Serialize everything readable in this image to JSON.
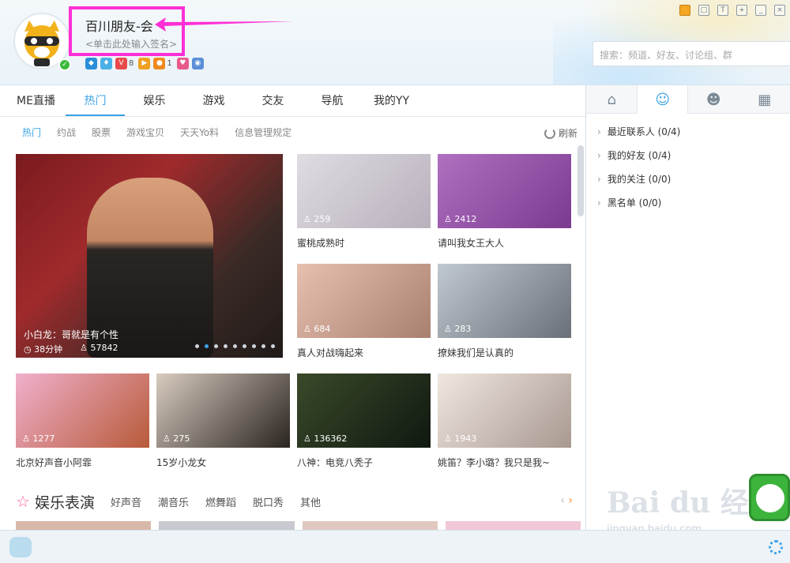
{
  "profile": {
    "nickname": "百川朋友-会",
    "signature": "<单击此处输入签名>",
    "badges": [
      {
        "icon": "game-icon",
        "color": "#2a8fd8",
        "count": ""
      },
      {
        "icon": "diamond-icon",
        "color": "#4ab0e6",
        "count": ""
      },
      {
        "icon": "vip-icon",
        "color": "#e84a4a",
        "count": "8"
      },
      {
        "icon": "play-icon",
        "color": "#f0a020",
        "count": ""
      },
      {
        "icon": "group-icon",
        "color": "#f08a20",
        "count": "1"
      },
      {
        "icon": "heart-icon",
        "color": "#e85a8a",
        "count": ""
      },
      {
        "icon": "eye-icon",
        "color": "#5a8fd8",
        "count": ""
      }
    ]
  },
  "search": {
    "placeholder": "搜索：频道、好友、讨论组、群"
  },
  "tabs": [
    "ME直播",
    "热门",
    "娱乐",
    "游戏",
    "交友",
    "导航",
    "我的YY"
  ],
  "subtabs": [
    "热门",
    "约战",
    "股票",
    "游戏宝贝",
    "天天Yo料",
    "信息管理规定"
  ],
  "refresh_label": "刷新",
  "featured": {
    "title": "小白龙：哥就是有个性",
    "duration": "38分钟",
    "viewers": "57842"
  },
  "tiles": [
    {
      "caption": "蜜桃成熟时",
      "viewers": "259",
      "color": "#c9c2cc"
    },
    {
      "caption": "请叫我女王大人",
      "viewers": "2412",
      "color": "#9a5aa8"
    },
    {
      "caption": "真人对战嗨起来",
      "viewers": "684",
      "color": "#c8a090"
    },
    {
      "caption": "撩妹我们是认真的",
      "viewers": "283",
      "color": "#9aa0a8"
    },
    {
      "caption": "北京好声音小阿霏",
      "viewers": "1277",
      "color": "#e89ab8"
    },
    {
      "caption": "15岁小龙女",
      "viewers": "275",
      "color": "#5a5048"
    },
    {
      "caption": "八神：电竞八秃子",
      "viewers": "136362",
      "color": "#2a3a2a"
    },
    {
      "caption": "姚笛？李小璐？我只是我~",
      "viewers": "1943",
      "color": "#d8c8c8"
    }
  ],
  "section": {
    "title": "娱乐表演",
    "links": [
      "好声音",
      "潮音乐",
      "燃舞蹈",
      "脱口秀",
      "其他"
    ]
  },
  "contacts": [
    "最近联系人 (0/4)",
    "我的好友 (0/4)",
    "我的关注 (0/0)",
    "黑名单 (0/0)"
  ],
  "watermark": {
    "main": "Bai du 经验",
    "sub": "jingyan.baidu.com"
  }
}
